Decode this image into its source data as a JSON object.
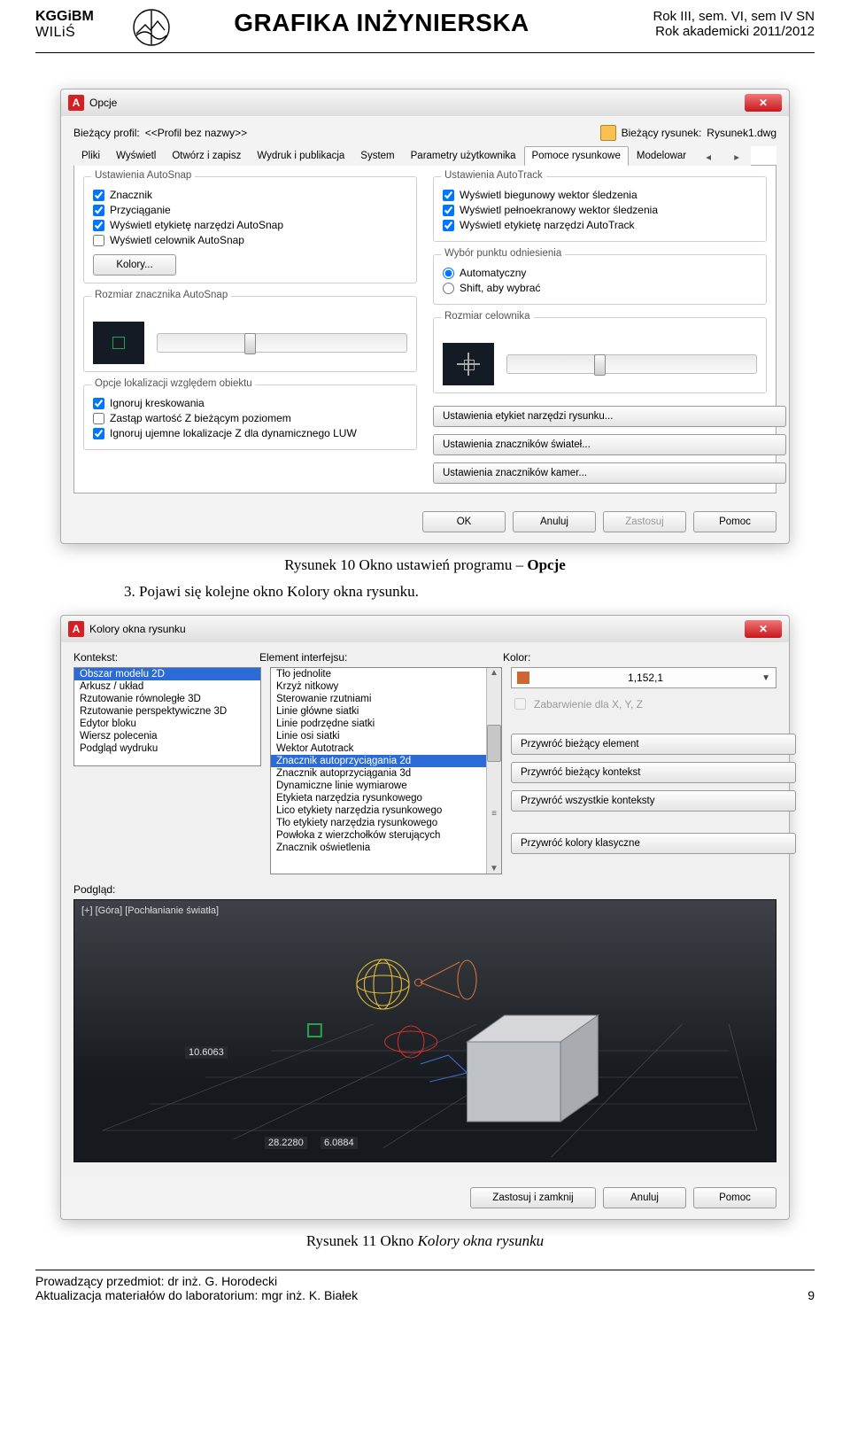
{
  "header": {
    "left_line1": "KGGiBM",
    "left_line2": "WILiŚ",
    "center": "GRAFIKA INŻYNIERSKA",
    "right_line1": "Rok III, sem. VI, sem IV SN",
    "right_line2": "Rok akademicki 2011/2012"
  },
  "opcje": {
    "title": "Opcje",
    "profile_lbl": "Bieżący profil:",
    "profile_val": "<<Profil bez nazwy>>",
    "drawing_lbl": "Bieżący rysunek:",
    "drawing_val": "Rysunek1.dwg",
    "tabs": [
      "Pliki",
      "Wyświetl",
      "Otwórz i zapisz",
      "Wydruk i publikacja",
      "System",
      "Parametry użytkownika",
      "Pomoce rysunkowe",
      "Modelowar"
    ],
    "tab_active": 6,
    "grp_autosnap": {
      "title": "Ustawienia AutoSnap",
      "items": [
        {
          "label": "Znacznik",
          "checked": true
        },
        {
          "label": "Przyciąganie",
          "checked": true
        },
        {
          "label": "Wyświetl etykietę narzędzi AutoSnap",
          "checked": true
        },
        {
          "label": "Wyświetl celownik AutoSnap",
          "checked": false
        }
      ],
      "colors_btn": "Kolory..."
    },
    "grp_autotrack": {
      "title": "Ustawienia AutoTrack",
      "items": [
        {
          "label": "Wyświetl biegunowy wektor śledzenia",
          "checked": true
        },
        {
          "label": "Wyświetl pełnoekranowy wektor śledzenia",
          "checked": true
        },
        {
          "label": "Wyświetl etykietę narzędzi AutoTrack",
          "checked": true
        }
      ]
    },
    "grp_punkt": {
      "title": "Wybór punktu odniesienia",
      "r1": "Automatyczny",
      "r2": "Shift, aby wybrać"
    },
    "grp_marker_size": "Rozmiar znacznika AutoSnap",
    "grp_aperture": "Rozmiar celownika",
    "grp_lok": {
      "title": "Opcje lokalizacji względem obiektu",
      "items": [
        {
          "label": "Ignoruj kreskowania",
          "checked": true
        },
        {
          "label": "Zastąp wartość Z bieżącym poziomem",
          "checked": false
        },
        {
          "label": "Ignoruj ujemne lokalizacje Z dla dynamicznego LUW",
          "checked": true
        }
      ]
    },
    "rbtn1": "Ustawienia etykiet narzędzi rysunku...",
    "rbtn2": "Ustawienia znaczników świateł...",
    "rbtn3": "Ustawienia znaczników kamer...",
    "foot": {
      "ok": "OK",
      "cancel": "Anuluj",
      "apply": "Zastosuj",
      "help": "Pomoc"
    }
  },
  "caption1_pre": "Rysunek 10 Okno ustawień programu – ",
  "caption1_bold": "Opcje",
  "body_line_pre": "3.  Pojawi się kolejne okno ",
  "body_line_bold": "Kolory okna rysunku",
  "body_line_post": ".",
  "kolory": {
    "title": "Kolory okna rysunku",
    "lbl_kontekst": "Kontekst:",
    "lbl_element": "Element interfejsu:",
    "lbl_kolor": "Kolor:",
    "kontekst": [
      "Obszar modelu 2D",
      "Arkusz / układ",
      "Rzutowanie równoległe 3D",
      "Rzutowanie perspektywiczne 3D",
      "Edytor bloku",
      "Wiersz polecenia",
      "Podgląd wydruku"
    ],
    "kontekst_sel": 0,
    "element": [
      "Tło jednolite",
      "Krzyż nitkowy",
      "Sterowanie rzutniami",
      "Linie główne siatki",
      "Linie podrzędne siatki",
      "Linie osi siatki",
      "Wektor Autotrack",
      "Znacznik autoprzyciągania 2d",
      "Znacznik autoprzyciągania 3d",
      "Dynamiczne linie wymiarowe",
      "Etykieta narzędzia rysunkowego",
      "Lico etykiety narzędzia rysunkowego",
      "Tło etykiety narzędzia rysunkowego",
      "Powłoka z wierzchołków sterujących",
      "Znacznik oświetlenia"
    ],
    "element_sel": 7,
    "combo_val": "1,152,1",
    "tint_lbl": "Zabarwienie dla X, Y, Z",
    "btn_el": "Przywróć bieżący element",
    "btn_ctx": "Przywróć bieżący kontekst",
    "btn_all": "Przywróć wszystkie konteksty",
    "btn_classic": "Przywróć kolory klasyczne",
    "podglad": "Podgląd:",
    "hud": "[+] [Góra] [Pochłanianie światła]",
    "dim1": "10.6063",
    "dim2a": "28.2280",
    "dim2b": "6.0884",
    "foot": {
      "apply": "Zastosuj i zamknij",
      "cancel": "Anuluj",
      "help": "Pomoc"
    }
  },
  "caption2_pre": "Rysunek 11 Okno ",
  "caption2_it": "Kolory okna rysunku",
  "footer": {
    "line1": "Prowadzący przedmiot: dr inż. G. Horodecki",
    "line2": "Aktualizacja materiałów do laboratorium: mgr inż. K. Białek",
    "page": "9"
  }
}
